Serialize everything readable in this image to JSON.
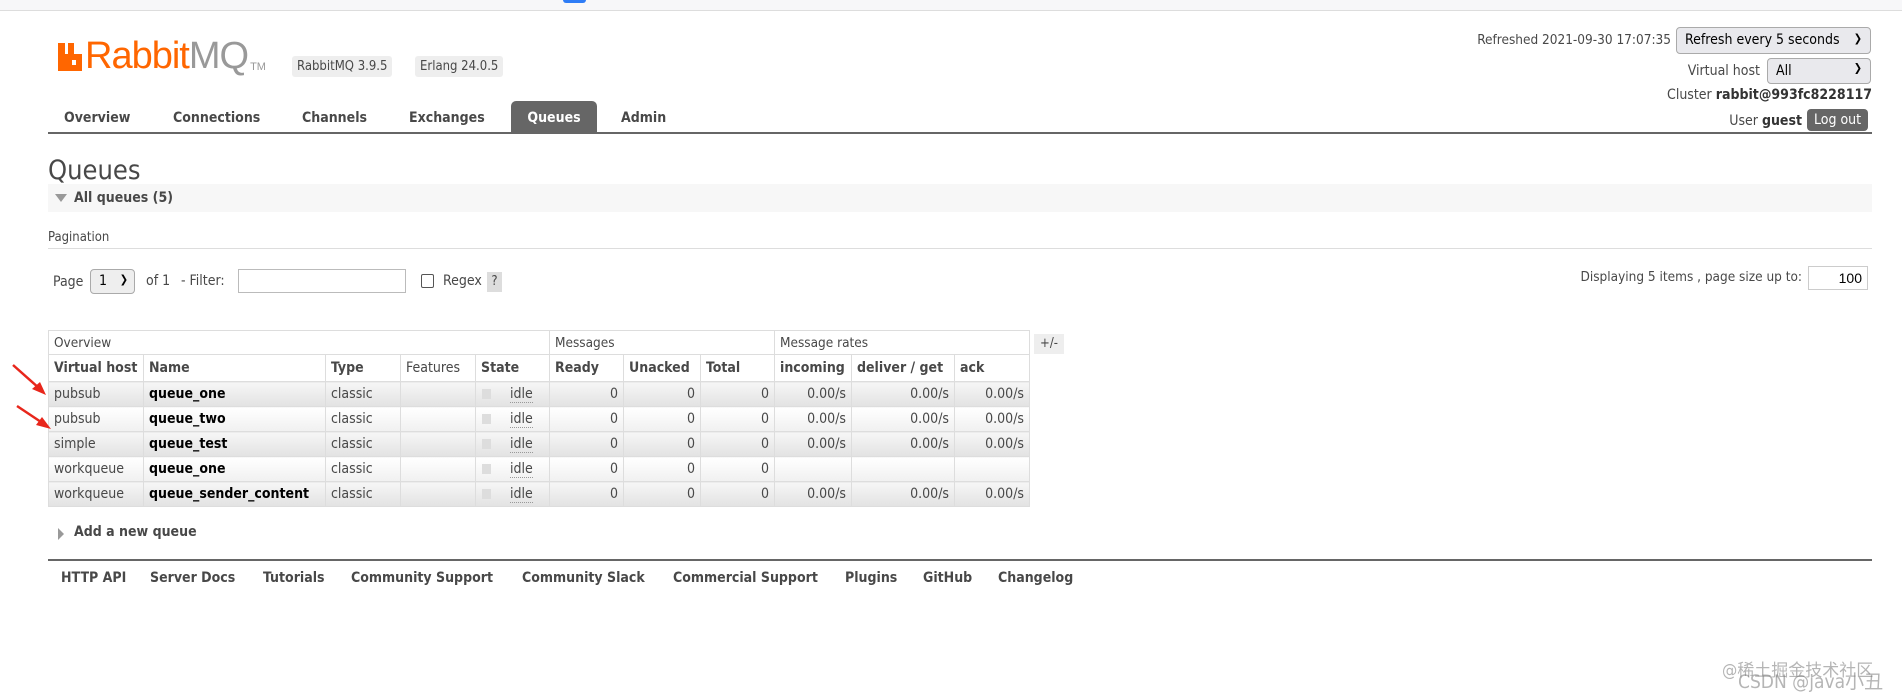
{
  "header": {
    "logo_text": "RabbitMQ",
    "logo_tm": "TM",
    "version_badge": "RabbitMQ 3.9.5",
    "erlang_badge": "Erlang 24.0.5",
    "refreshed_label": "Refreshed 2021-09-30 17:07:35",
    "refresh_select": "Refresh every 5 seconds",
    "vhost_label": "Virtual host",
    "vhost_select": "All",
    "cluster_label": "Cluster",
    "cluster_name": "rabbit@993fc8228117",
    "user_label": "User",
    "user_name": "guest",
    "logout_label": "Log out"
  },
  "nav": {
    "tabs": [
      {
        "label": "Overview"
      },
      {
        "label": "Connections"
      },
      {
        "label": "Channels"
      },
      {
        "label": "Exchanges"
      },
      {
        "label": "Queues",
        "active": true
      },
      {
        "label": "Admin"
      }
    ]
  },
  "page": {
    "title": "Queues",
    "section_title": "All queues (5)",
    "pagination_label": "Pagination",
    "page_label": "Page",
    "page_value": "1",
    "of_label": "of 1",
    "filter_label": "- Filter:",
    "filter_value": "",
    "regex_label": "Regex",
    "regex_help": "?",
    "displaying_label": "Displaying 5 items , page size up to:",
    "page_size": "100",
    "columns_toggle": "+/-",
    "add_queue_label": "Add a new queue"
  },
  "table": {
    "groups": [
      "Overview",
      "Messages",
      "Message rates"
    ],
    "headers": [
      "Virtual host",
      "Name",
      "Type",
      "Features",
      "State",
      "Ready",
      "Unacked",
      "Total",
      "incoming",
      "deliver / get",
      "ack"
    ],
    "rows": [
      {
        "vhost": "pubsub",
        "name": "queue_one",
        "type": "classic",
        "features": "",
        "state": "idle",
        "ready": "0",
        "unacked": "0",
        "total": "0",
        "incoming": "0.00/s",
        "deliver": "0.00/s",
        "ack": "0.00/s"
      },
      {
        "vhost": "pubsub",
        "name": "queue_two",
        "type": "classic",
        "features": "",
        "state": "idle",
        "ready": "0",
        "unacked": "0",
        "total": "0",
        "incoming": "0.00/s",
        "deliver": "0.00/s",
        "ack": "0.00/s"
      },
      {
        "vhost": "simple",
        "name": "queue_test",
        "type": "classic",
        "features": "",
        "state": "idle",
        "ready": "0",
        "unacked": "0",
        "total": "0",
        "incoming": "0.00/s",
        "deliver": "0.00/s",
        "ack": "0.00/s"
      },
      {
        "vhost": "workqueue",
        "name": "queue_one",
        "type": "classic",
        "features": "",
        "state": "idle",
        "ready": "0",
        "unacked": "0",
        "total": "0",
        "incoming": "",
        "deliver": "",
        "ack": ""
      },
      {
        "vhost": "workqueue",
        "name": "queue_sender_content",
        "type": "classic",
        "features": "",
        "state": "idle",
        "ready": "0",
        "unacked": "0",
        "total": "0",
        "incoming": "0.00/s",
        "deliver": "0.00/s",
        "ack": "0.00/s"
      }
    ]
  },
  "footer": {
    "links": [
      "HTTP API",
      "Server Docs",
      "Tutorials",
      "Community Support",
      "Community Slack",
      "Commercial Support",
      "Plugins",
      "GitHub",
      "Changelog"
    ]
  },
  "watermarks": [
    "@稀土掘金技术社区",
    "CSDN @java小丑"
  ],
  "colors": {
    "brand": "#ff6600",
    "active_tab": "#666666",
    "annotation_arrow": "#e8261b"
  }
}
